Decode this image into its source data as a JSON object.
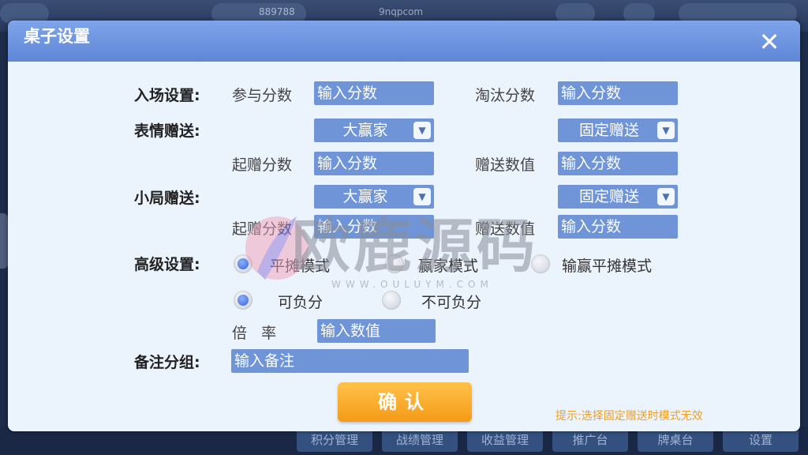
{
  "background": {
    "top_number": "889788",
    "site": "9nqpcom",
    "bottom_buttons": [
      "积分管理",
      "战绩管理",
      "收益管理",
      "推广台",
      "牌桌台",
      "设置"
    ]
  },
  "dialog": {
    "title": "桌子设置",
    "close": "✕",
    "entry": {
      "label": "入场设置:",
      "join_label": "参与分数",
      "join_placeholder": "输入分数",
      "elim_label": "淘汰分数",
      "elim_placeholder": "输入分数"
    },
    "emoji": {
      "label": "表情赠送:",
      "select_left": "大赢家",
      "select_right": "固定赠送",
      "start_label": "起赠分数",
      "start_placeholder": "输入分数",
      "value_label": "赠送数值",
      "value_placeholder": "输入分数"
    },
    "round": {
      "label": "小局赠送:",
      "select_left": "大赢家",
      "select_right": "固定赠送",
      "start_label": "起赠分数",
      "start_placeholder": "输入分数",
      "value_label": "赠送数值",
      "value_placeholder": "输入分数"
    },
    "advanced": {
      "label": "高级设置:",
      "modes": [
        {
          "label": "平摊模式",
          "selected": true
        },
        {
          "label": "赢家模式",
          "selected": false
        },
        {
          "label": "输赢平摊模式",
          "selected": false
        }
      ],
      "debt": [
        {
          "label": "可负分",
          "selected": true
        },
        {
          "label": "不可负分",
          "selected": false
        }
      ],
      "rate_label": "倍   率",
      "rate_placeholder": "输入数值"
    },
    "note": {
      "label": "备注分组:",
      "placeholder": "输入备注"
    },
    "confirm": "确认",
    "hint": "提示:选择固定赠送时模式无效"
  },
  "watermark": {
    "text": "欧鹿源码",
    "url": "WWW.OULUYM.COM"
  },
  "colors": {
    "title_bar": "#6e96e0",
    "field": "#6f95d8",
    "confirm": "#f5a020",
    "hint": "#f0a020"
  }
}
